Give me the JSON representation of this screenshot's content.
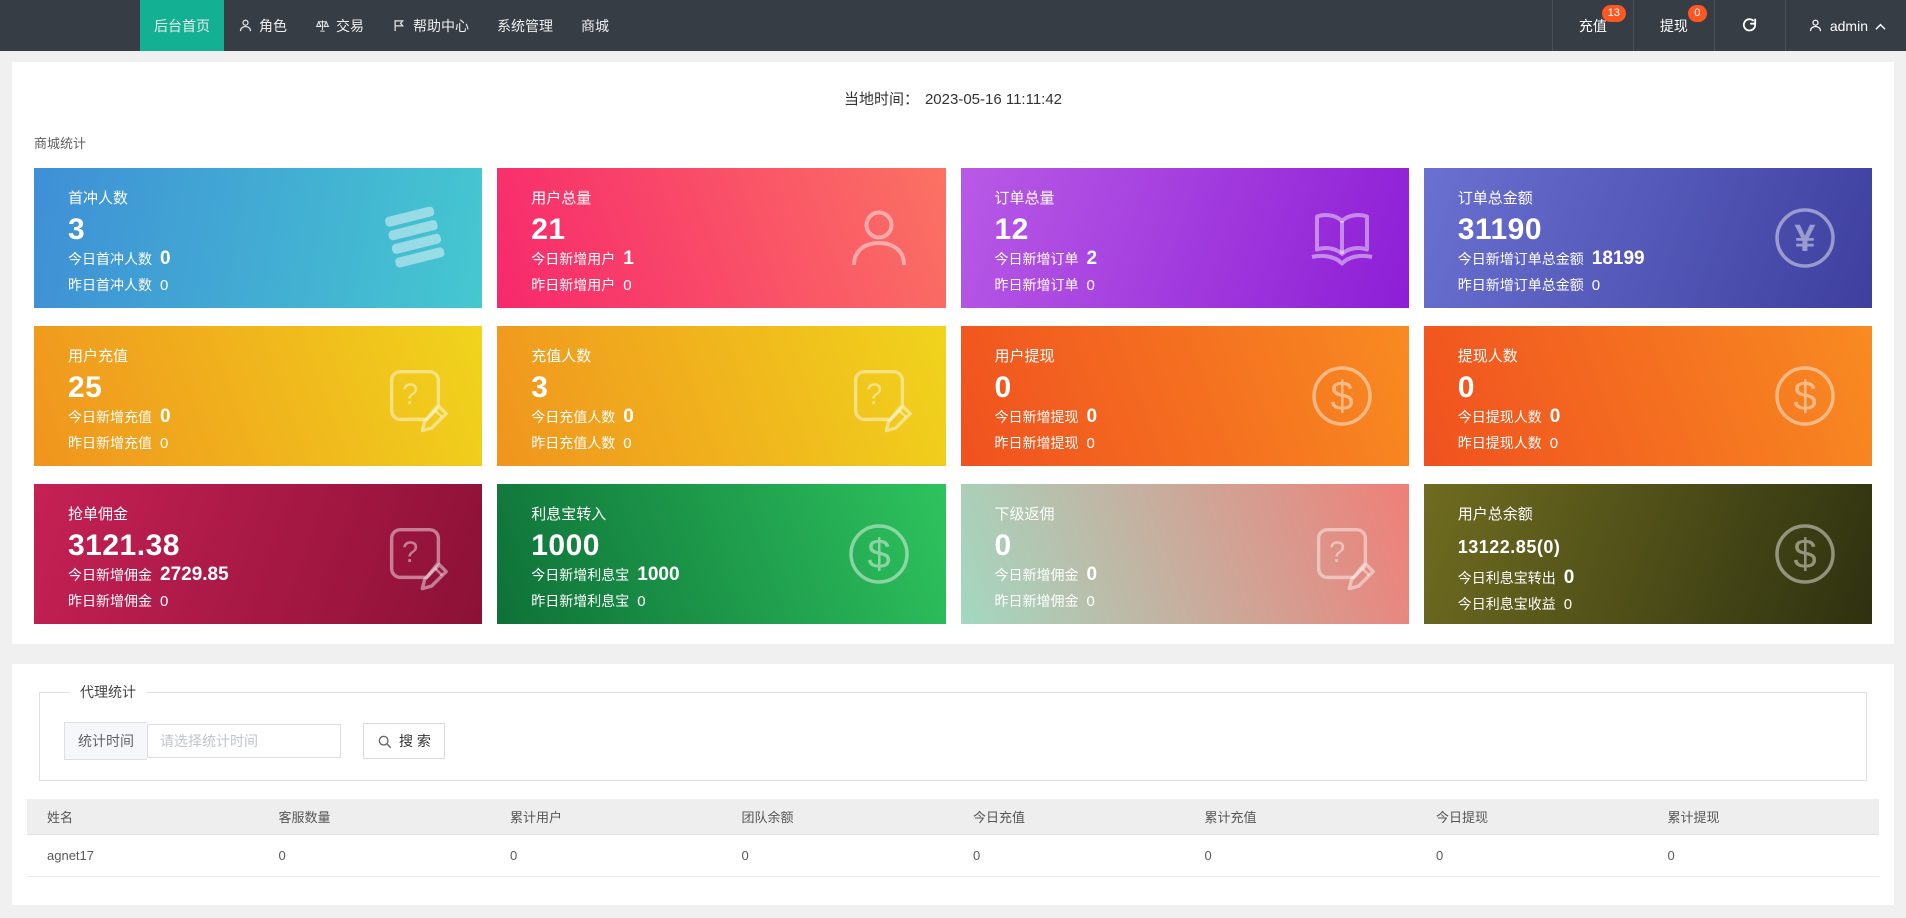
{
  "nav": {
    "items": [
      {
        "id": "home",
        "label": "后台首页",
        "active": true,
        "icon": null
      },
      {
        "id": "roles",
        "label": "角色",
        "active": false,
        "icon": "person-icon"
      },
      {
        "id": "trade",
        "label": "交易",
        "active": false,
        "icon": "scales-icon"
      },
      {
        "id": "help-center",
        "label": "帮助中心",
        "active": false,
        "icon": "flag-icon"
      },
      {
        "id": "system",
        "label": "系统管理",
        "active": false,
        "icon": null
      },
      {
        "id": "mall",
        "label": "商城",
        "active": false,
        "icon": null
      }
    ],
    "actions": [
      {
        "id": "recharge",
        "label": "充值",
        "badge": "13"
      },
      {
        "id": "withdraw",
        "label": "提现",
        "badge": "0"
      }
    ],
    "user": "admin",
    "badge_color": "#ff5722",
    "active_color": "#13b093"
  },
  "time_bar": {
    "label": "当地时间：",
    "value": "2023-05-16 11:11:42"
  },
  "stats": {
    "title": "商城统计",
    "cards": [
      {
        "id": "first-recharge-users",
        "title": "首冲人数",
        "value": "3",
        "line2_label": "今日首冲人数",
        "line2_value": "0",
        "line3_label": "昨日首冲人数",
        "line3_value": "0",
        "icon": "layers-icon",
        "gradient": {
          "angle": "100deg",
          "from": "#3f8fd6",
          "to": "#45c8d0"
        }
      },
      {
        "id": "total-users",
        "title": "用户总量",
        "value": "21",
        "line2_label": "今日新增用户",
        "line2_value": "1",
        "line3_label": "昨日新增用户",
        "line3_value": "0",
        "icon": "user-icon",
        "gradient": {
          "angle": "70deg",
          "from": "#f7286d",
          "to": "#fb7263"
        }
      },
      {
        "id": "total-orders",
        "title": "订单总量",
        "value": "12",
        "line2_label": "今日新增订单",
        "line2_value": "2",
        "line3_label": "昨日新增订单",
        "line3_value": "0",
        "icon": "book-icon",
        "gradient": {
          "angle": "110deg",
          "from": "#b85ae6",
          "to": "#8d1ed6"
        }
      },
      {
        "id": "total-order-amount",
        "title": "订单总金额",
        "value": "31190",
        "line2_label": "今日新增订单总金额",
        "line2_value": "18199",
        "line3_label": "昨日新增订单总金额",
        "line3_value": "0",
        "icon": "yen-icon",
        "gradient": {
          "angle": "110deg",
          "from": "#6a71d1",
          "to": "#3e3f9e"
        }
      },
      {
        "id": "user-recharge",
        "title": "用户充值",
        "value": "25",
        "line2_label": "今日新增充值",
        "line2_value": "0",
        "line3_label": "昨日新增充值",
        "line3_value": "0",
        "icon": "edit-doc-icon",
        "gradient": {
          "angle": "70deg",
          "from": "#f0941e",
          "to": "#f0d41c"
        }
      },
      {
        "id": "recharge-users",
        "title": "充值人数",
        "value": "3",
        "line2_label": "今日充值人数",
        "line2_value": "0",
        "line3_label": "昨日充值人数",
        "line3_value": "0",
        "icon": "edit-doc-icon",
        "gradient": {
          "angle": "70deg",
          "from": "#f0941e",
          "to": "#f0d41c"
        }
      },
      {
        "id": "user-withdraw",
        "title": "用户提现",
        "value": "0",
        "line2_label": "今日新增提现",
        "line2_value": "0",
        "line3_label": "昨日新增提现",
        "line3_value": "0",
        "icon": "dollar-icon",
        "gradient": {
          "angle": "70deg",
          "from": "#f0511f",
          "to": "#f88b21"
        }
      },
      {
        "id": "withdraw-users",
        "title": "提现人数",
        "value": "0",
        "line2_label": "今日提现人数",
        "line2_value": "0",
        "line3_label": "昨日提现人数",
        "line3_value": "0",
        "icon": "dollar-icon",
        "gradient": {
          "angle": "70deg",
          "from": "#f0511f",
          "to": "#f88b21"
        }
      },
      {
        "id": "order-commission",
        "title": "抢单佣金",
        "value": "3121.38",
        "line2_label": "今日新增佣金",
        "line2_value": "2729.85",
        "line3_label": "昨日新增佣金",
        "line3_value": "0",
        "icon": "edit-doc-icon",
        "gradient": {
          "angle": "110deg",
          "from": "#c52154",
          "to": "#8c1136"
        }
      },
      {
        "id": "interest-transfer-in",
        "title": "利息宝转入",
        "value": "1000",
        "line2_label": "今日新增利息宝",
        "line2_value": "1000",
        "line3_label": "昨日新增利息宝",
        "line3_value": "0",
        "icon": "dollar-icon",
        "gradient": {
          "angle": "70deg",
          "from": "#0e7138",
          "to": "#2ec35e"
        }
      },
      {
        "id": "sub-rebate",
        "title": "下级返佣",
        "value": "0",
        "line2_label": "今日新增佣金",
        "line2_value": "0",
        "line3_label": "昨日新增佣金",
        "line3_value": "0",
        "icon": "edit-doc-icon",
        "gradient": {
          "angle": "70deg",
          "from": "#a3d8c0",
          "to": "#ef7f78"
        }
      },
      {
        "id": "user-total-balance",
        "title": "用户总余额",
        "value": "13122.85(0)",
        "line2_label": "今日利息宝转出",
        "line2_value": "0",
        "line3_label": "今日利息宝收益",
        "line3_value": "0",
        "icon": "dollar-icon",
        "gradient": {
          "angle": "110deg",
          "from": "#6f6c20",
          "to": "#2e3110"
        }
      }
    ]
  },
  "agent": {
    "title": "代理统计",
    "time_label": "统计时间",
    "placeholder": "请选择统计时间",
    "search_label": "搜 索",
    "table": {
      "headers": [
        "姓名",
        "客服数量",
        "累计用户",
        "团队余额",
        "今日充值",
        "累计充值",
        "今日提现",
        "累计提现"
      ],
      "rows": [
        [
          "agnet17",
          "0",
          "0",
          "0",
          "0",
          "0",
          "0",
          "0"
        ]
      ]
    }
  }
}
